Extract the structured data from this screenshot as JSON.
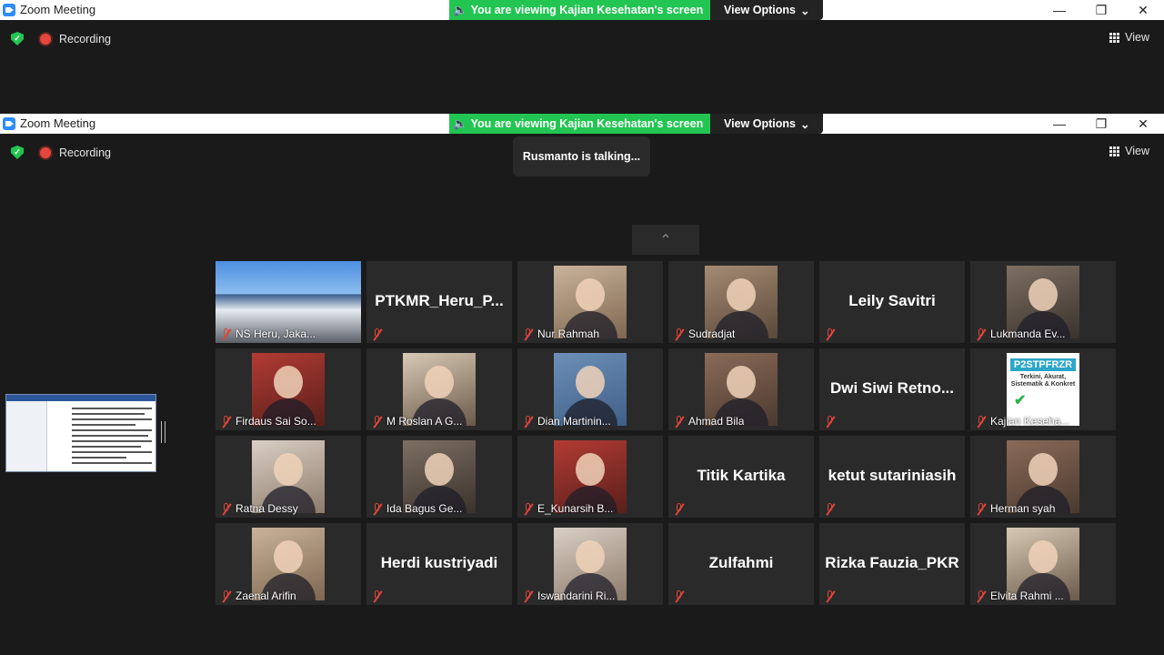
{
  "app": {
    "title": "Zoom Meeting",
    "share_banner": "You are viewing Kajian Kesehatan's screen",
    "view_options": "View Options",
    "recording": "Recording",
    "view_label": "View",
    "talking": "Rusmanto is talking...",
    "colors": {
      "banner_green": "#23c552",
      "rec_red": "#e5473d",
      "mute_red": "#e0453b",
      "tile_bg": "#2a2a2a"
    }
  },
  "participants": [
    {
      "name": "NS Heru, Jaka...",
      "type": "photo-full"
    },
    {
      "name": "PTKMR_Heru_P...",
      "type": "name-only"
    },
    {
      "name": "Nur Rahmah",
      "type": "photo"
    },
    {
      "name": "Sudradjat",
      "type": "photo"
    },
    {
      "name": "Leily Savitri",
      "type": "name-only"
    },
    {
      "name": "Lukmanda Ev...",
      "type": "photo"
    },
    {
      "name": "Firdaus Sai So...",
      "type": "photo"
    },
    {
      "name": "M Roslan A G...",
      "type": "photo"
    },
    {
      "name": "Dian Martinin...",
      "type": "photo"
    },
    {
      "name": "Ahmad Bila",
      "type": "photo"
    },
    {
      "name": "Dwi Siwi Retno...",
      "type": "name-only"
    },
    {
      "name": "Kajian Keseha...",
      "type": "photo-logo",
      "logo_text": "P2STPFRZR",
      "logo_sub": "Terkini, Akurat, Sistematik & Konkret"
    },
    {
      "name": "Ratna Dessy",
      "type": "photo"
    },
    {
      "name": "Ida Bagus Ge...",
      "type": "photo"
    },
    {
      "name": "E_Kunarsih B...",
      "type": "photo"
    },
    {
      "name": "Titik Kartika",
      "type": "name-only"
    },
    {
      "name": "ketut sutariniasih",
      "type": "name-only"
    },
    {
      "name": "Herman syah",
      "type": "photo"
    },
    {
      "name": "Zaenal Arifin",
      "type": "photo"
    },
    {
      "name": "Herdi kustriyadi",
      "type": "name-only"
    },
    {
      "name": "Iswandarini Ri...",
      "type": "photo"
    },
    {
      "name": "Zulfahmi",
      "type": "name-only"
    },
    {
      "name": "Rizka Fauzia_PKR",
      "type": "name-only"
    },
    {
      "name": "Elvita Rahmi ...",
      "type": "photo"
    }
  ]
}
